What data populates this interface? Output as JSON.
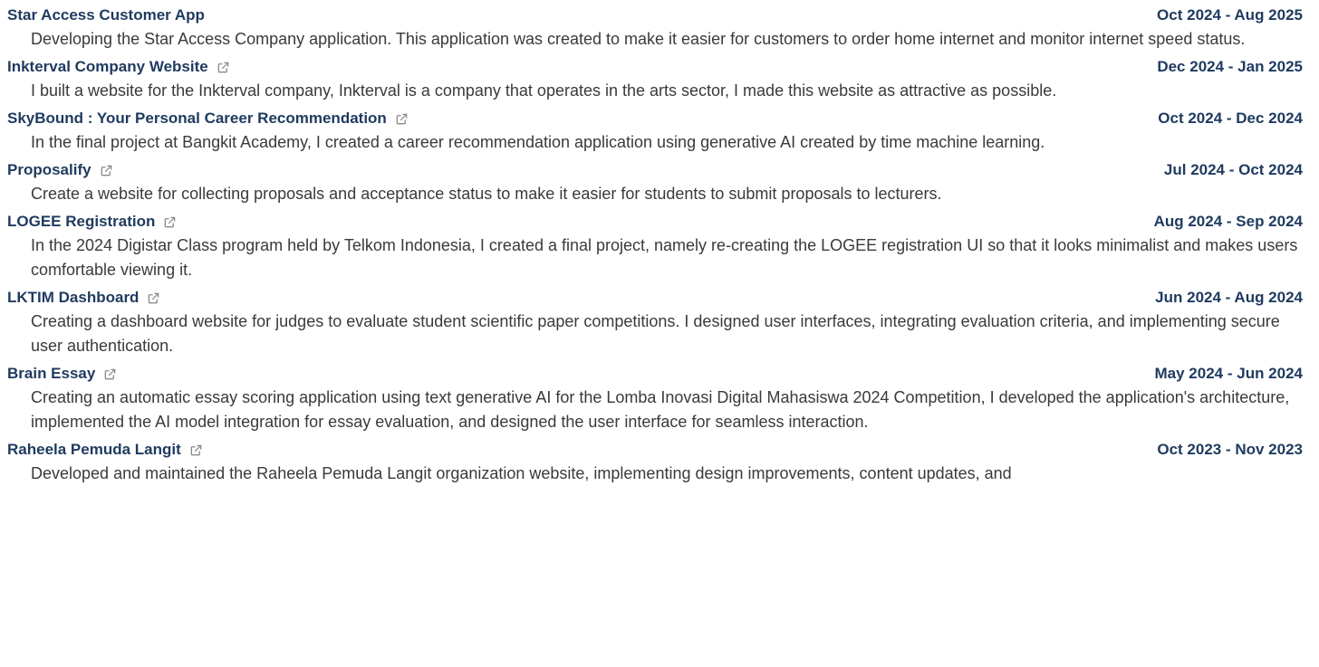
{
  "projects": [
    {
      "title": "Star Access Customer App",
      "has_link": false,
      "date": "Oct 2024 - Aug 2025",
      "description": "Developing the Star Access Company application. This application was created to make it easier for customers to order home internet and monitor internet speed status."
    },
    {
      "title": "Inkterval Company Website",
      "has_link": true,
      "date": "Dec 2024 - Jan 2025",
      "description": "I built a website for the Inkterval company, Inkterval is a company that operates in the arts sector, I made this website as attractive as possible."
    },
    {
      "title": "SkyBound : Your Personal Career Recommendation",
      "has_link": true,
      "date": "Oct 2024 - Dec 2024",
      "description": "In the final project at Bangkit Academy, I created a career recommendation application using generative AI created by time machine learning."
    },
    {
      "title": "Proposalify",
      "has_link": true,
      "date": "Jul 2024 - Oct 2024",
      "description": "Create a website for collecting proposals and acceptance status to make it easier for students to submit proposals to lecturers."
    },
    {
      "title": "LOGEE Registration",
      "has_link": true,
      "date": "Aug 2024 - Sep 2024",
      "description": "In the 2024 Digistar Class program held by Telkom Indonesia, I created a final project, namely re-creating the LOGEE registration UI so that it looks minimalist and makes users comfortable viewing it."
    },
    {
      "title": "LKTIM Dashboard",
      "has_link": true,
      "date": "Jun 2024 - Aug 2024",
      "description": "Creating a dashboard website for judges to evaluate student scientific paper competitions. I designed user interfaces, integrating evaluation criteria, and implementing secure user authentication."
    },
    {
      "title": "Brain Essay",
      "has_link": true,
      "date": "May 2024 - Jun 2024",
      "description": "Creating an automatic essay scoring application using text generative AI for the Lomba Inovasi Digital Mahasiswa 2024 Competition, I developed the application's architecture, implemented the AI model integration for essay evaluation, and designed the user interface for seamless interaction."
    },
    {
      "title": "Raheela Pemuda Langit",
      "has_link": true,
      "date": "Oct 2023 - Nov 2023",
      "description": "Developed and maintained the Raheela Pemuda Langit organization website, implementing design improvements, content updates, and"
    }
  ],
  "icons": {
    "external_link": "external-link-icon"
  },
  "colors": {
    "title": "#1f3a5f",
    "text": "#3a3a3a",
    "icon": "#8a8a8a"
  }
}
